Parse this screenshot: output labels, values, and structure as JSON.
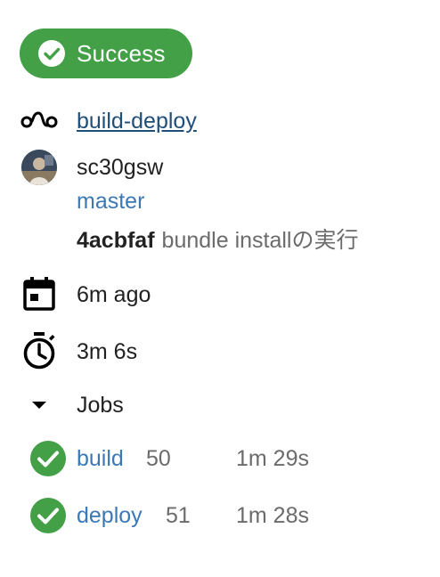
{
  "status": {
    "label": "Success",
    "color": "#43a047",
    "icon": "check-circle-icon"
  },
  "workflow": {
    "name": "build-deploy",
    "icon": "workflow-icon"
  },
  "author": {
    "username": "sc30gsw",
    "avatar": "avatar"
  },
  "branch": "master",
  "commit": {
    "sha": "4acbfaf",
    "message": "bundle installの実行"
  },
  "started": {
    "icon": "calendar-icon",
    "text": "6m ago"
  },
  "duration": {
    "icon": "stopwatch-icon",
    "text": "3m 6s"
  },
  "jobs": {
    "toggle_icon": "caret-down-icon",
    "label": "Jobs",
    "items": [
      {
        "name": "build",
        "number": "50",
        "duration": "1m 29s",
        "status": "success"
      },
      {
        "name": "deploy",
        "number": "51",
        "duration": "1m 28s",
        "status": "success"
      }
    ]
  }
}
